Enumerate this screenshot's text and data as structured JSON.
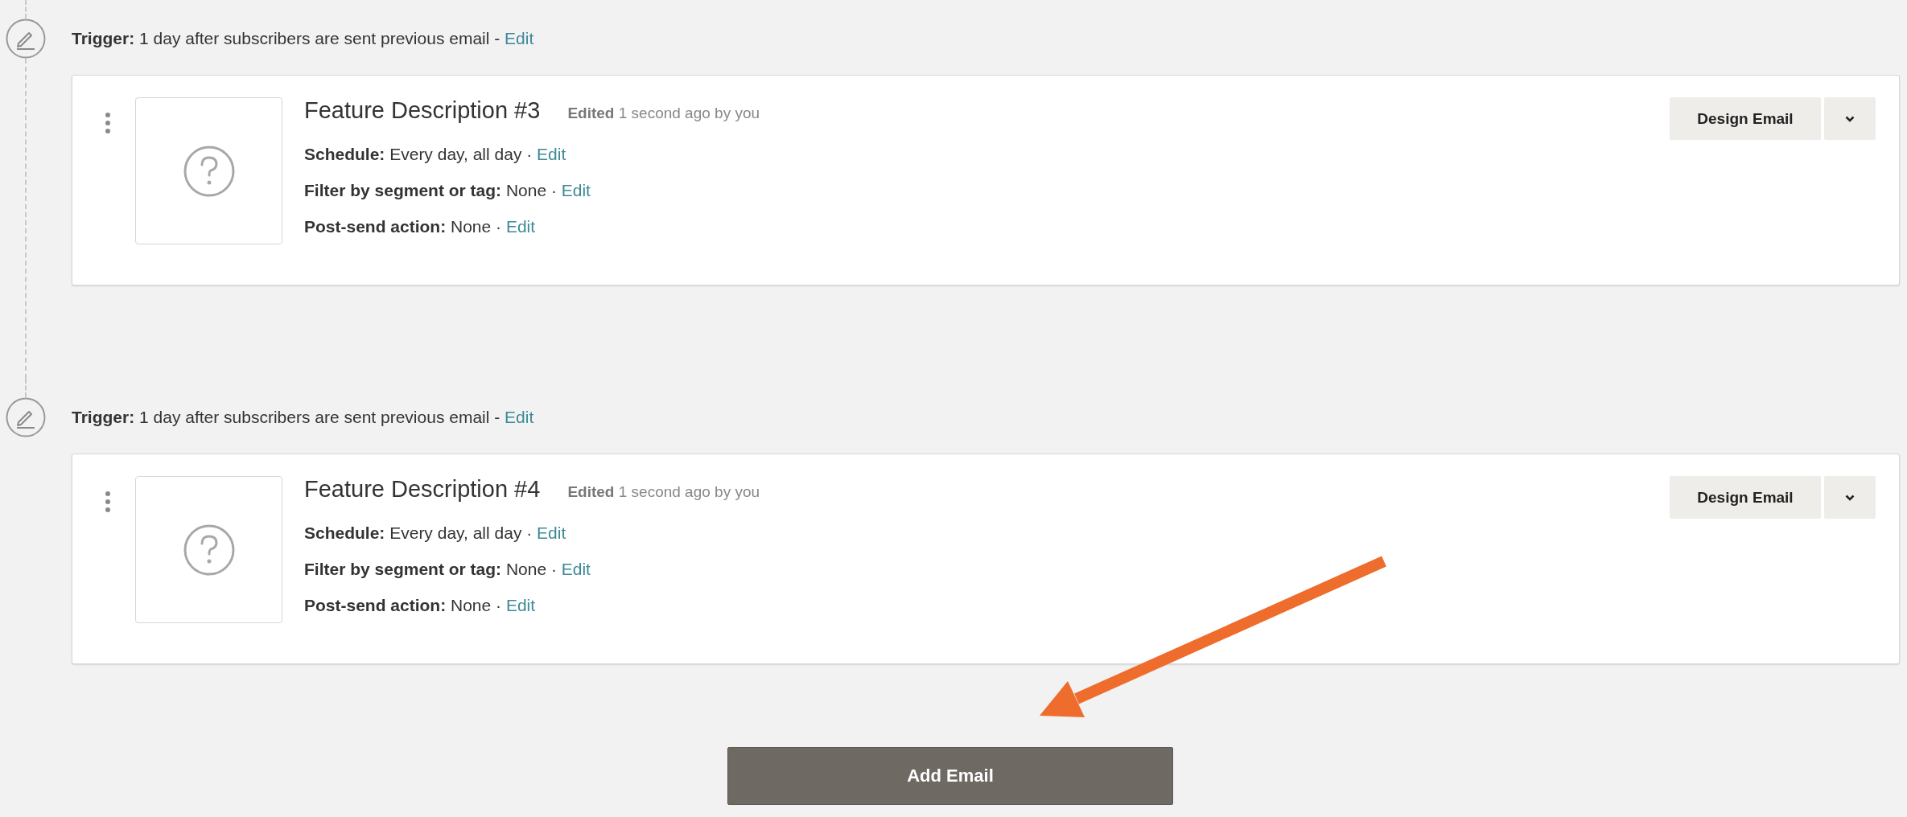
{
  "steps": [
    {
      "trigger": {
        "text": "**Trigger:** 1 day after subscribers are sent previous email -",
        "link": "Edit"
      },
      "email": {
        "title": "Feature Description #3",
        "edited": "**Edited** 1 second ago by you",
        "settings": [
          {
            "text": "**Schedule:** Every day, all day ·",
            "link": "Edit"
          },
          {
            "text": "**Filter by segment or tag:** None ·",
            "link": "Edit"
          },
          {
            "text": "**Post-send action:** None ·",
            "link": "Edit"
          }
        ],
        "design_button": "Design Email"
      }
    },
    {
      "trigger": {
        "text": "**Trigger:** 1 day after subscribers are sent previous email -",
        "link": "Edit"
      },
      "email": {
        "title": "Feature Description #4",
        "edited": "**Edited** 1 second ago by you",
        "settings": [
          {
            "text": "**Schedule:** Every day, all day ·",
            "link": "Edit"
          },
          {
            "text": "**Filter by segment or tag:** None ·",
            "link": "Edit"
          },
          {
            "text": "**Post-send action:** None ·",
            "link": "Edit"
          }
        ],
        "design_button": "Design Email"
      }
    }
  ],
  "add_button": "Add Email"
}
